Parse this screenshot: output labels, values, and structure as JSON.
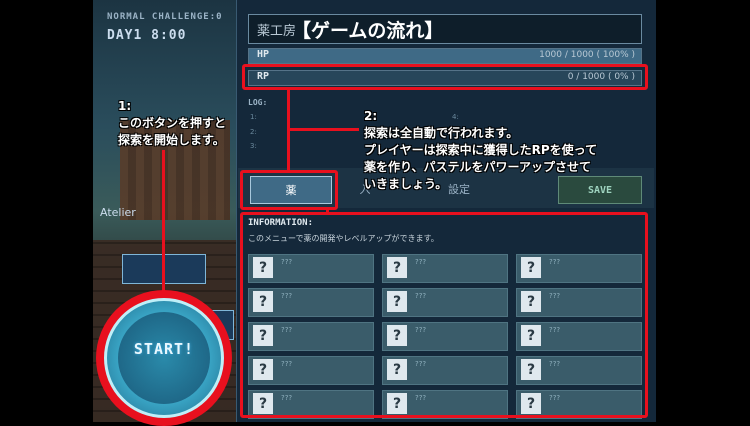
{
  "hud": {
    "challenge": "NORMAL CHALLENGE:0",
    "day": "DAY1 8:00",
    "location": "Atelier"
  },
  "panel": {
    "title": "薬工房",
    "hp_label": "HP",
    "hp_value": "1000 / 1000 ( 100% )",
    "hp_fraction": 1.0,
    "rp_label": "RP",
    "rp_value": "0 / 1000 ( 0% )",
    "rp_fraction": 0.0,
    "log_label": "LOG:",
    "log_rows": [
      "1:",
      "2:",
      "3:",
      "4:"
    ],
    "tabs": [
      "薬",
      "入",
      "設定"
    ],
    "save_label": "SAVE",
    "info_heading": "INFORMATION:",
    "info_text": "このメニューで薬の開発やレベルアップができます。",
    "slot_symbol": "?",
    "slot_text": "???",
    "slot_count": 15
  },
  "start_button": {
    "label": "START!"
  },
  "overlay": {
    "title": "【ゲームの流れ】",
    "note1": [
      "1:",
      "このボタンを押すと",
      "探索を開始します。"
    ],
    "note2": [
      "2:",
      "探索は全自動で行われます。",
      "プレイヤーは探索中に獲得したRPを使って",
      "薬を作り、パステルをパワーアップさせて",
      "いきましょう。"
    ]
  },
  "colors": {
    "highlight": "#e8101e",
    "panel": "#14283a"
  }
}
